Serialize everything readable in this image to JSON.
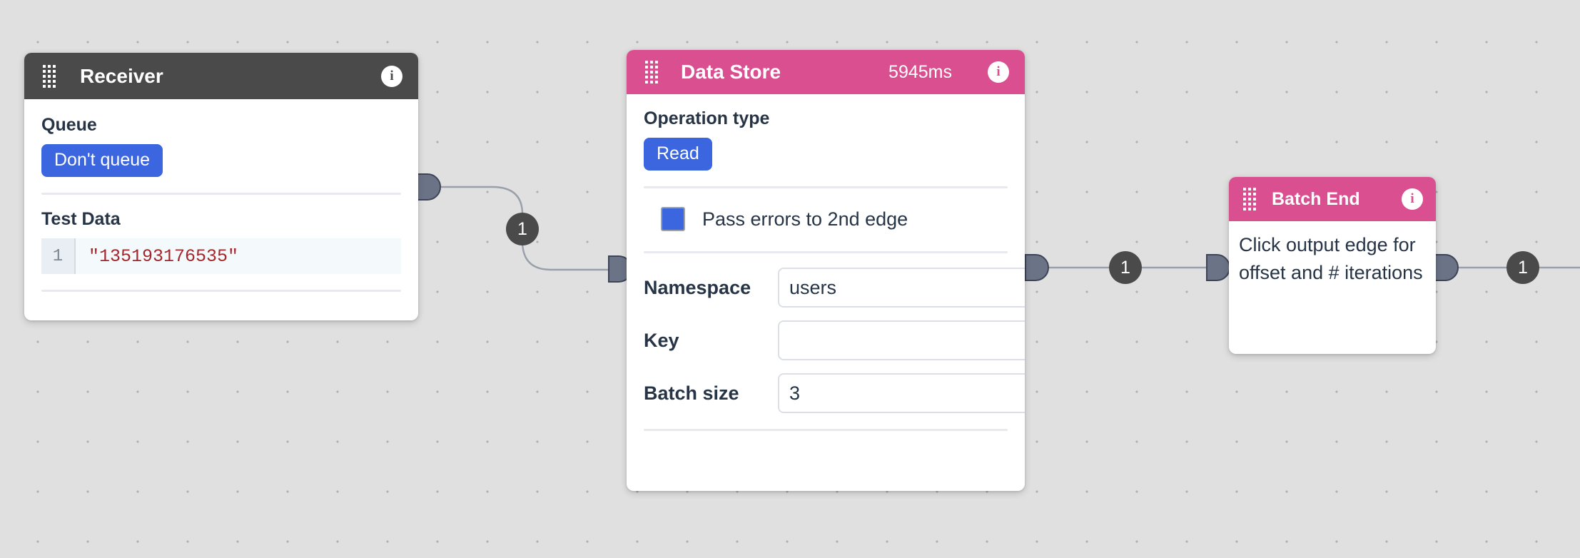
{
  "canvas": {
    "background_color": "#e0e0e0",
    "grid_dot_color": "#b0b0b0"
  },
  "nodes": [
    {
      "id": "receiver",
      "title": "Receiver",
      "header_color": "#4a4a4a",
      "drag_handle_icon": "drag-dots-icon",
      "info_icon": "info-icon",
      "info_glyph": "i",
      "fields": {
        "queue_label": "Queue",
        "queue_value": "Don't queue",
        "test_data_label": "Test Data",
        "code_line_number": "1",
        "code_line_text": "\"135193176535\""
      }
    },
    {
      "id": "datastore",
      "title": "Data Store",
      "header_color": "#d94f8f",
      "timing": "5945ms",
      "drag_handle_icon": "drag-dots-icon",
      "info_icon": "info-icon",
      "info_glyph": "i",
      "fields": {
        "operation_type_label": "Operation type",
        "operation_type_value": "Read",
        "pass_errors_label": "Pass errors to 2nd edge",
        "pass_errors_checked": true,
        "namespace_label": "Namespace",
        "namespace_value": "users",
        "key_label": "Key",
        "key_value": "",
        "key_placeholder": "",
        "batch_size_label": "Batch size",
        "batch_size_value": "3"
      }
    },
    {
      "id": "batchend",
      "title": "Batch End",
      "header_color": "#d94f8f",
      "drag_handle_icon": "drag-dots-icon",
      "info_icon": "info-icon",
      "info_glyph": "i",
      "fields": {
        "hint": "Click output edge for offset and # iterations"
      }
    }
  ],
  "edges": [
    {
      "id": "edge-receiver-datastore",
      "count": "1"
    },
    {
      "id": "edge-datastore-batchend",
      "count": "1"
    },
    {
      "id": "edge-batchend-next",
      "count": "1"
    }
  ],
  "colors": {
    "accent_blue": "#3b66e0",
    "pink_header": "#d94f8f",
    "dark_header": "#4a4a4a",
    "port_fill": "#6b7487",
    "code_string": "#a3272d"
  }
}
